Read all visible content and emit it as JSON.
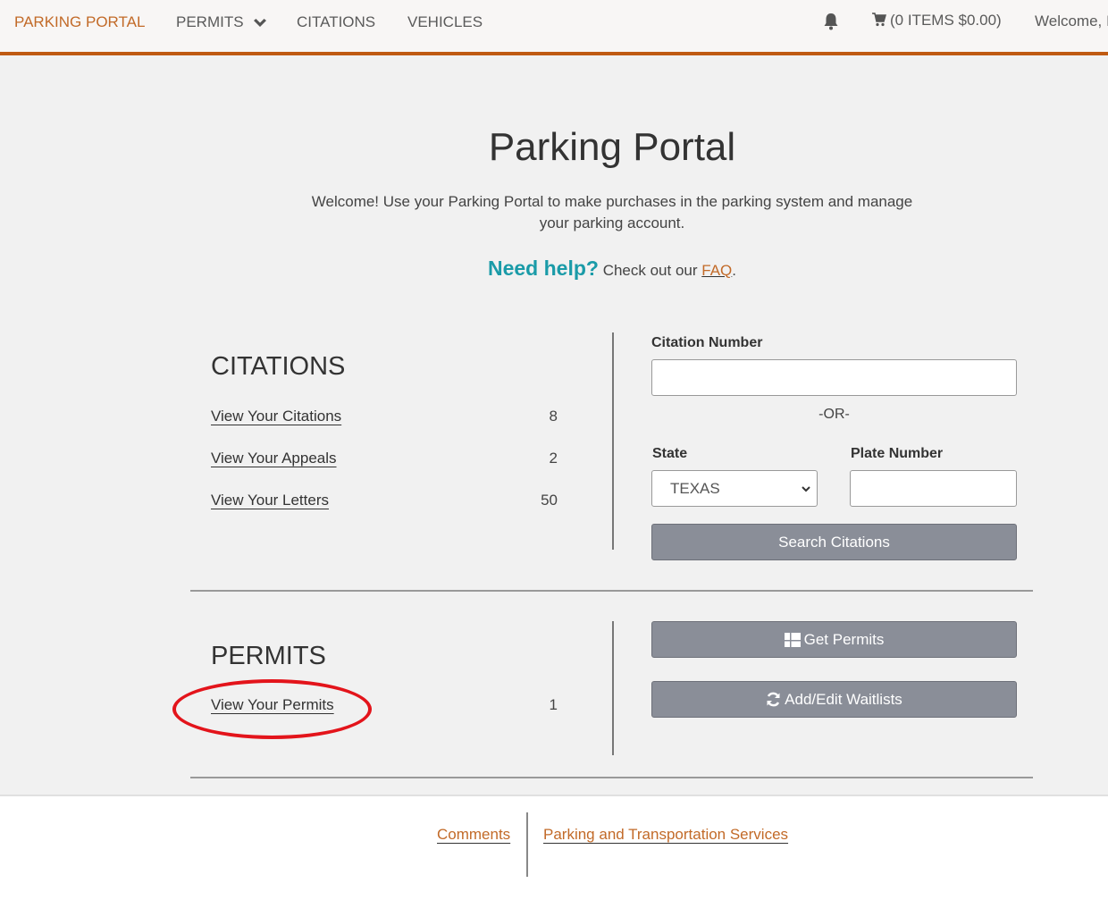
{
  "nav": {
    "brand": "PARKING PORTAL",
    "items": [
      {
        "label": "PERMITS",
        "has_dropdown": true
      },
      {
        "label": "CITATIONS"
      },
      {
        "label": "VEHICLES"
      }
    ],
    "notification_icon": "bell-icon",
    "cart": {
      "icon": "cart-icon",
      "label": "(0 ITEMS $0.00)"
    },
    "welcome": "Welcome, I"
  },
  "hero": {
    "title": "Parking Portal",
    "text": "Welcome! Use your Parking Portal to make purchases in the parking system and manage your parking account.",
    "help_prefix": "Need help?",
    "help_text": "Check out our",
    "faq_link": "FAQ",
    "help_suffix": "."
  },
  "citations": {
    "title": "CITATIONS",
    "links": [
      {
        "label": "View Your Citations",
        "count": "8"
      },
      {
        "label": "View Your Appeals",
        "count": "2"
      },
      {
        "label": "View Your Letters",
        "count": "50"
      }
    ],
    "search": {
      "citation_number_label": "Citation Number",
      "citation_number_value": "",
      "or_text": "-OR-",
      "state_label": "State",
      "state_value": "TEXAS",
      "plate_label": "Plate Number",
      "plate_value": "",
      "button_label": "Search Citations"
    }
  },
  "permits": {
    "title": "PERMITS",
    "links": [
      {
        "label": "View Your Permits",
        "count": "1"
      }
    ],
    "buttons": [
      {
        "label": "Get Permits",
        "icon": "grid-icon"
      },
      {
        "label": "Add/Edit Waitlists",
        "icon": "refresh-icon"
      }
    ]
  },
  "footer": {
    "links": [
      "Comments",
      "Parking and Transportation Services"
    ]
  },
  "colors": {
    "accent": "#bf5a12",
    "link_orange": "#c26a28",
    "help_teal": "#1a9ba8",
    "button_gray": "#8a8e98",
    "annotation_red": "#e3141b"
  }
}
